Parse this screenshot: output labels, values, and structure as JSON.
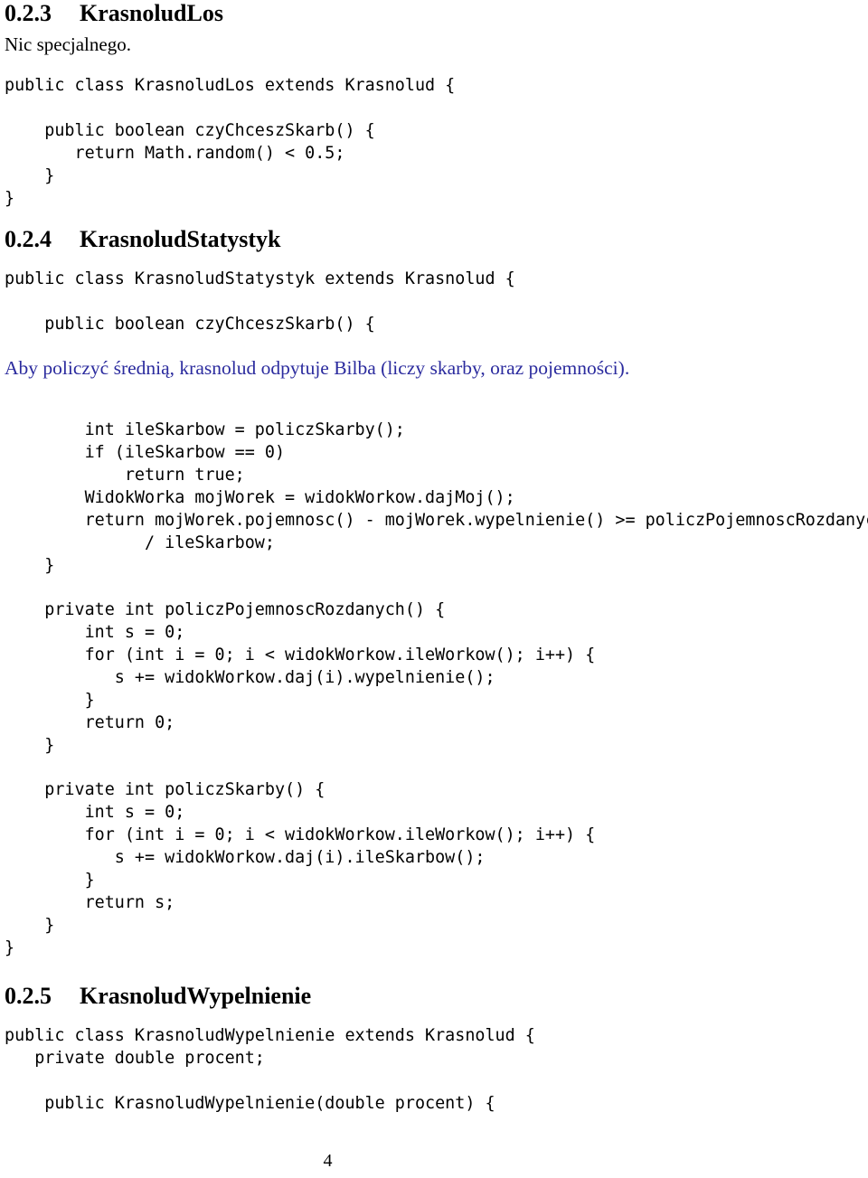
{
  "page": {
    "folio": "4",
    "background": "#ffffff",
    "text_color": "#000000",
    "accent_blue": "#2b2b9e"
  },
  "sections": [
    {
      "number": "0.2.3",
      "title": "KrasnoludLos",
      "note": "Nic specjalnego.",
      "code": "public class KrasnoludLos extends Krasnolud {\n\n    public boolean czyChceszSkarb() {\n       return Math.random() < 0.5;\n    }\n}"
    },
    {
      "number": "0.2.4",
      "title": "KrasnoludStatystyk",
      "code_head": "public class KrasnoludStatystyk extends Krasnolud {\n\n    public boolean czyChceszSkarb() {",
      "blue_note": "Aby policzyć średnią, krasnolud odpytuje Bilba (liczy skarby, oraz pojemności).",
      "code_body_1": "        int ileSkarbow = policzSkarby();\n        if (ileSkarbow == 0)\n            return true;\n        WidokWorka mojWorek = widokWorkow.dajMoj();\n        return mojWorek.pojemnosc() - mojWorek.wypelnienie() >= policzPojemnoscRozdanych()\n              / ileSkarbow;\n    }",
      "code_body_2": "    private int policzPojemnoscRozdanych() {\n        int s = 0;\n        for (int i = 0; i < widokWorkow.ileWorkow(); i++) {\n           s += widokWorkow.daj(i).wypelnienie();\n        }\n        return 0;\n    }",
      "code_body_3": "    private int policzSkarby() {\n        int s = 0;\n        for (int i = 0; i < widokWorkow.ileWorkow(); i++) {\n           s += widokWorkow.daj(i).ileSkarbow();\n        }\n        return s;\n    }\n}"
    },
    {
      "number": "0.2.5",
      "title": "KrasnoludWypelnienie",
      "code_head": "public class KrasnoludWypelnienie extends Krasnolud {\n   private double procent;\n\n    public KrasnoludWypelnienie(double procent) {"
    }
  ]
}
